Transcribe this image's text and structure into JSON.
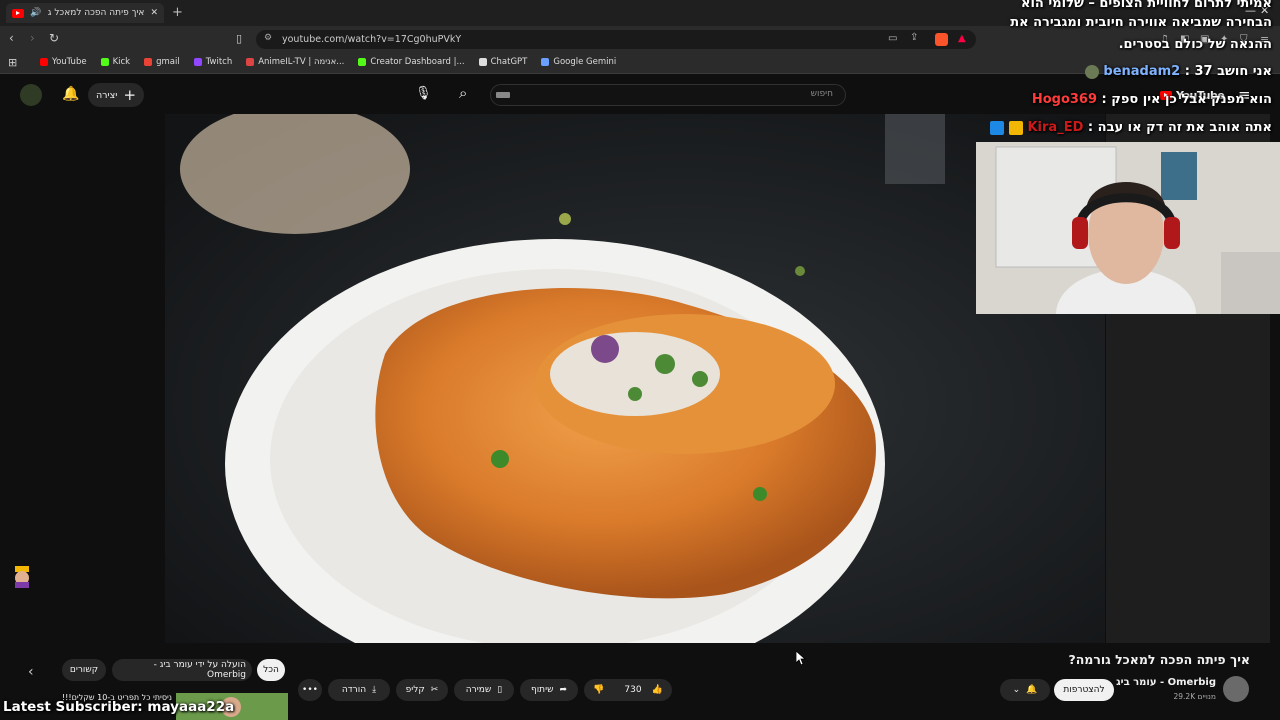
{
  "browser": {
    "tab_title": "איך פיתה הפכה למאכל גורמה",
    "url": "youtube.com/watch?v=17Cg0huPVkY",
    "bookmarks": [
      {
        "label": "YouTube",
        "color": "#ff0000"
      },
      {
        "label": "Kick",
        "color": "#53fc18"
      },
      {
        "label": "gmail",
        "color": "#ea4335"
      },
      {
        "label": "Twitch",
        "color": "#9146ff"
      },
      {
        "label": "AnimeIL-TV | אנימה...",
        "color": "#d44"
      },
      {
        "label": "Creator Dashboard |...",
        "color": "#53fc18"
      },
      {
        "label": "ChatGPT",
        "color": "#ddd"
      },
      {
        "label": "Google Gemini",
        "color": "#6aa0ff"
      }
    ]
  },
  "youtube": {
    "search_placeholder": "חיפוש",
    "create_label": "יצירה",
    "logo_text": "YouTube",
    "video_title": "איך פיתה הפכה למאכל גורמה?",
    "channel_name": "עומר ביג - Omerbig",
    "subscribers": "29.2K מנויים",
    "subscribe_label": "להצטרפות",
    "likes": "730",
    "share_label": "שיתוף",
    "save_label": "שמירה",
    "clip_label": "קליפ",
    "download_label": "הורדה",
    "filter_chips": [
      "הכל",
      "הועלה על ידי עומר ביג - Omerbig",
      "קשורים"
    ],
    "rec_title": "ניסיתי כל תפריט ב-10 שקלים!!!"
  },
  "overlay": {
    "chat": [
      {
        "text": "אמיתי לתרום לחוויית הצופים – שלומי הוא",
        "color": "#ffffff"
      },
      {
        "text": "הבחירה שמביאה אווירה חיובית ומגבירה את",
        "color": "#ffffff"
      },
      {
        "text": "ההנאה של כולם בסטרים.",
        "color": "#ffffff"
      },
      {
        "user": "benadam2",
        "user_color": "#7fb3ff",
        "text": "אני חושב 37"
      },
      {
        "user": "Hogo369",
        "user_color": "#ff3b3b",
        "text": "הוא מפנק אבל כן אין ספק"
      },
      {
        "user": "Kira_ED",
        "user_color": "#cc1a1a",
        "text": "אתה אוהב את זה דק או עבה"
      }
    ],
    "latest_subscriber": "Latest Subscriber: mayaaa22a"
  }
}
